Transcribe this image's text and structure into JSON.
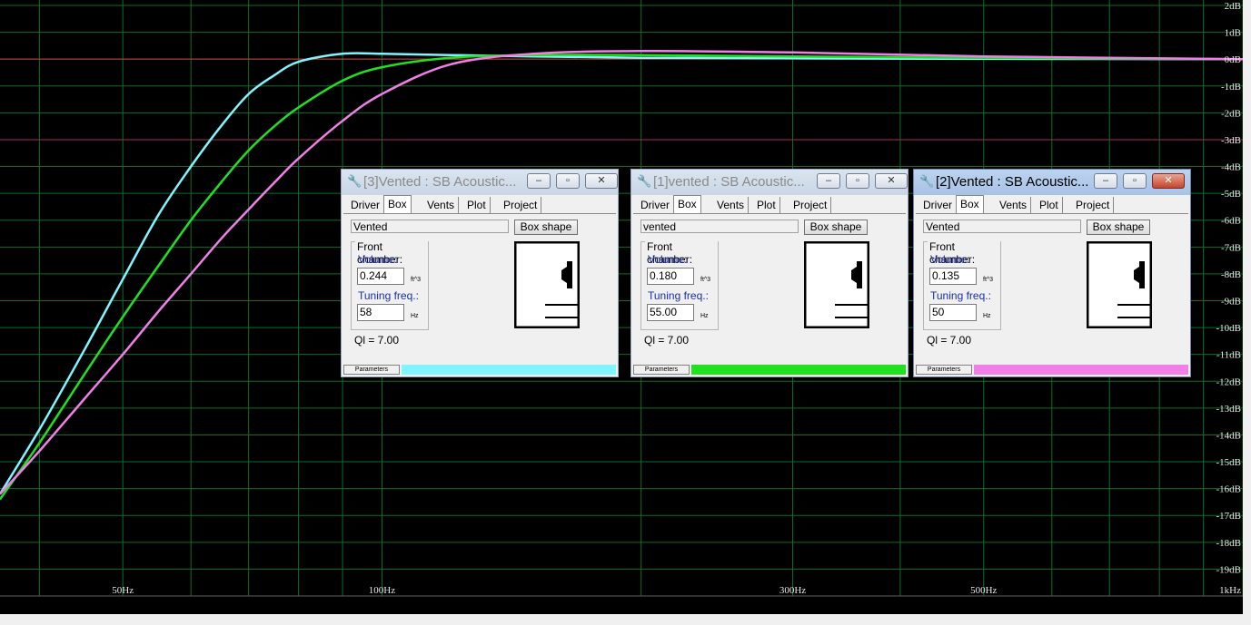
{
  "chart_data": {
    "type": "line",
    "xscale": "log",
    "xlim": [
      36,
      1000
    ],
    "ylim": [
      -20,
      2
    ],
    "x_ticks": [
      {
        "value": 50,
        "label": "50Hz"
      },
      {
        "value": 100,
        "label": "100Hz"
      },
      {
        "value": 300,
        "label": "300Hz"
      },
      {
        "value": 500,
        "label": "500Hz"
      },
      {
        "value": 1000,
        "label": "1kHz"
      }
    ],
    "y_ticks": [
      {
        "value": 2,
        "label": "2dB"
      },
      {
        "value": 1,
        "label": "1dB"
      },
      {
        "value": 0,
        "label": "0dB"
      },
      {
        "value": -1,
        "label": "-1dB"
      },
      {
        "value": -2,
        "label": "-2dB"
      },
      {
        "value": -3,
        "label": "-3dB"
      },
      {
        "value": -4,
        "label": "-4dB"
      },
      {
        "value": -5,
        "label": "-5dB"
      },
      {
        "value": -6,
        "label": "-6dB"
      },
      {
        "value": -7,
        "label": "-7dB"
      },
      {
        "value": -8,
        "label": "-8dB"
      },
      {
        "value": -9,
        "label": "-9dB"
      },
      {
        "value": -10,
        "label": "-10dB"
      },
      {
        "value": -11,
        "label": "-11dB"
      },
      {
        "value": -12,
        "label": "-12dB"
      },
      {
        "value": -13,
        "label": "-13dB"
      },
      {
        "value": -14,
        "label": "-14dB"
      },
      {
        "value": -15,
        "label": "-15dB"
      },
      {
        "value": -16,
        "label": "-16dB"
      },
      {
        "value": -17,
        "label": "-17dB"
      },
      {
        "value": -18,
        "label": "-18dB"
      },
      {
        "value": -19,
        "label": "-19dB"
      },
      {
        "value": -20,
        "label": "1kHz"
      }
    ],
    "reference_lines": [
      {
        "value": 0,
        "color": "#c04040"
      },
      {
        "value": -3,
        "color": "#a03060"
      }
    ],
    "grid": true,
    "series": [
      {
        "color": "#80f4ff",
        "x": [
          36,
          40,
          45,
          50,
          55,
          60,
          65,
          70,
          75,
          80,
          90,
          100,
          120,
          150,
          200,
          300,
          500,
          1000
        ],
        "y": [
          -16.2,
          -13.8,
          -10.9,
          -8.2,
          -5.8,
          -4.0,
          -2.5,
          -1.3,
          -0.6,
          -0.1,
          0.2,
          0.2,
          0.15,
          0.1,
          0.05,
          0.03,
          0.01,
          0.0
        ]
      },
      {
        "color": "#20e020",
        "x": [
          36,
          40,
          45,
          50,
          55,
          60,
          65,
          70,
          75,
          80,
          90,
          100,
          120,
          150,
          200,
          300,
          500,
          1000
        ],
        "y": [
          -16.4,
          -14.3,
          -11.8,
          -9.6,
          -7.7,
          -6.0,
          -4.6,
          -3.4,
          -2.5,
          -1.8,
          -0.8,
          -0.3,
          0.05,
          0.15,
          0.15,
          0.1,
          0.05,
          0.0
        ]
      },
      {
        "color": "#f080e8",
        "x": [
          36,
          40,
          45,
          50,
          55,
          60,
          65,
          70,
          75,
          80,
          90,
          100,
          120,
          150,
          200,
          300,
          500,
          1000
        ],
        "y": [
          -16.2,
          -14.6,
          -12.7,
          -11.0,
          -9.4,
          -8.0,
          -6.7,
          -5.6,
          -4.6,
          -3.7,
          -2.3,
          -1.3,
          -0.2,
          0.2,
          0.3,
          0.25,
          0.1,
          0.0
        ]
      }
    ]
  },
  "windows": [
    {
      "title": "[3]Vented : SB Acoustic...",
      "tabs": [
        "Driver",
        "Box",
        "Vents",
        "Plot",
        "Project"
      ],
      "selected_tab": "Box",
      "box_type": "Vented",
      "box_shape_label": "Box shape",
      "group_label": "Front chamber:",
      "volume_label": "Volume:",
      "volume_value": "0.244",
      "volume_unit": "ft^3",
      "tuning_label": "Tuning freq.:",
      "tuning_value": "58",
      "tuning_unit": "Hz",
      "ql": "Ql = 7.00",
      "status_label": "Parameters",
      "color": "#80f4ff",
      "active": false
    },
    {
      "title": "[1]vented : SB Acoustic...",
      "tabs": [
        "Driver",
        "Box",
        "Vents",
        "Plot",
        "Project"
      ],
      "selected_tab": "Box",
      "box_type": "vented",
      "box_shape_label": "Box shape",
      "group_label": "Front chamber:",
      "volume_label": "Volume:",
      "volume_value": "0.180",
      "volume_unit": "ft^3",
      "tuning_label": "Tuning freq.:",
      "tuning_value": "55.00",
      "tuning_unit": "Hz",
      "ql": "Ql = 7.00",
      "status_label": "Parameters",
      "color": "#20e020",
      "active": false
    },
    {
      "title": "[2]Vented : SB Acoustic...",
      "tabs": [
        "Driver",
        "Box",
        "Vents",
        "Plot",
        "Project"
      ],
      "selected_tab": "Box",
      "box_type": "Vented",
      "box_shape_label": "Box shape",
      "group_label": "Front chamber:",
      "volume_label": "Volume:",
      "volume_value": "0.135",
      "volume_unit": "ft^3",
      "tuning_label": "Tuning freq.:",
      "tuning_value": "50",
      "tuning_unit": "Hz",
      "ql": "Ql = 7.00",
      "status_label": "Parameters",
      "color": "#f080e8",
      "active": true
    }
  ],
  "icons": {
    "window_icon": "speaker-tool-icon",
    "minimize": "minimize-icon",
    "maximize": "maximize-icon",
    "close": "close-icon"
  }
}
